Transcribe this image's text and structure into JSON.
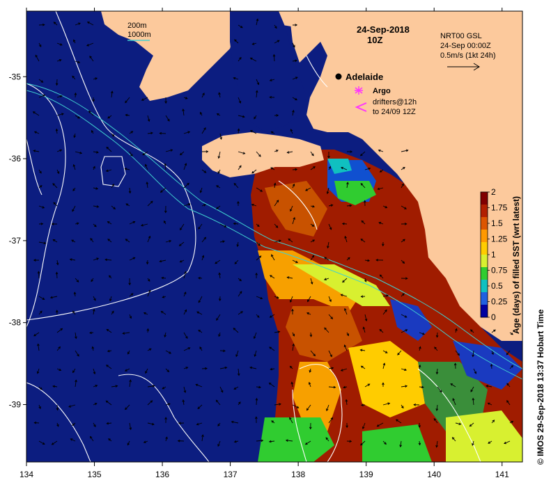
{
  "map": {
    "date_line": "24-Sep-2018",
    "time_line": "10Z",
    "bathymetry_legend": {
      "line1": "200m",
      "line2": "1000m"
    },
    "current_legend": {
      "line1": "NRT00 GSL",
      "line2": "24-Sep 00:00Z",
      "line3": "0.5m/s (1kt 24h)"
    },
    "city_label": "Adelaide",
    "argo_label": "Argo",
    "drifter_legend": {
      "line1": "drifters@12h",
      "line2": "to 24/09 12Z"
    },
    "credit": "© IMOS 29-Sep-2018 13:37 Hobart Time",
    "x_ticks": [
      "134",
      "135",
      "136",
      "137",
      "138",
      "139",
      "140",
      "141"
    ],
    "y_ticks": [
      "-35",
      "-36",
      "-37",
      "-38",
      "-39"
    ],
    "x_range_deg": [
      134,
      141.3
    ],
    "y_range_deg": [
      -34.2,
      -39.7
    ]
  },
  "colorbar": {
    "title": "Age (days) of filled SST (wrt latest)",
    "ticks": [
      "2",
      "1.75",
      "1.5",
      "1.25",
      "1",
      "0.75",
      "0.5",
      "0.25",
      "0"
    ],
    "colors": [
      "#800000",
      "#b22000",
      "#dd5500",
      "#ff9900",
      "#ffcc00",
      "#d8f030",
      "#30cc30",
      "#10c0c0",
      "#2060e0",
      "#0000a0"
    ]
  },
  "colors": {
    "ocean": "#0c1d80",
    "land": "#fcc99c",
    "isobath": "#40d0d0",
    "contour": "#ffffff",
    "argo": "#ff33ff"
  }
}
